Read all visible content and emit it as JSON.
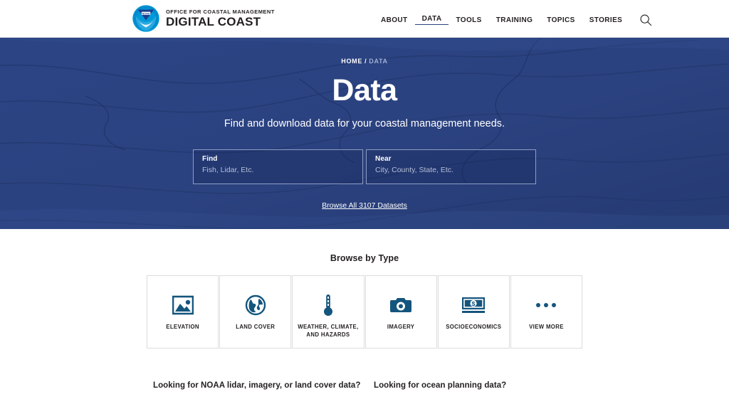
{
  "header": {
    "logo_alt": "NOAA",
    "brand_sub": "OFFICE FOR COASTAL MANAGEMENT",
    "brand_title": "DIGITAL COAST",
    "nav": [
      {
        "label": "ABOUT",
        "active": false
      },
      {
        "label": "DATA",
        "active": true
      },
      {
        "label": "TOOLS",
        "active": false
      },
      {
        "label": "TRAINING",
        "active": false
      },
      {
        "label": "TOPICS",
        "active": false
      },
      {
        "label": "STORIES",
        "active": false
      }
    ],
    "search_icon": "search-icon"
  },
  "hero": {
    "breadcrumb": {
      "home": "HOME",
      "separator": "/",
      "current": "DATA"
    },
    "title": "Data",
    "subtitle": "Find and download data for your coastal management needs.",
    "search": {
      "find": {
        "label": "Find",
        "value": "",
        "placeholder": "Fish, Lidar, Etc."
      },
      "near": {
        "label": "Near",
        "value": "",
        "placeholder": "City, County, State, Etc."
      }
    },
    "browse_all_label": "Browse All 3107 Datasets",
    "dataset_count": "3107",
    "background_color": "#2b4280"
  },
  "browse": {
    "heading": "Browse by Type",
    "icon_color": "#14557d",
    "cards": [
      {
        "label": "ELEVATION",
        "icon": "image-mountain-icon"
      },
      {
        "label": "LAND COVER",
        "icon": "globe-icon"
      },
      {
        "label": "WEATHER, CLIMATE, AND HAZARDS",
        "icon": "thermometer-icon"
      },
      {
        "label": "IMAGERY",
        "icon": "camera-icon"
      },
      {
        "label": "SOCIOECONOMICS",
        "icon": "banknote-dollar-icon"
      },
      {
        "label": "VIEW MORE",
        "icon": "ellipsis-icon"
      }
    ]
  },
  "promos": [
    {
      "title": "Looking for NOAA lidar, imagery, or land cover data?"
    },
    {
      "title": "Looking for ocean planning data?"
    }
  ]
}
